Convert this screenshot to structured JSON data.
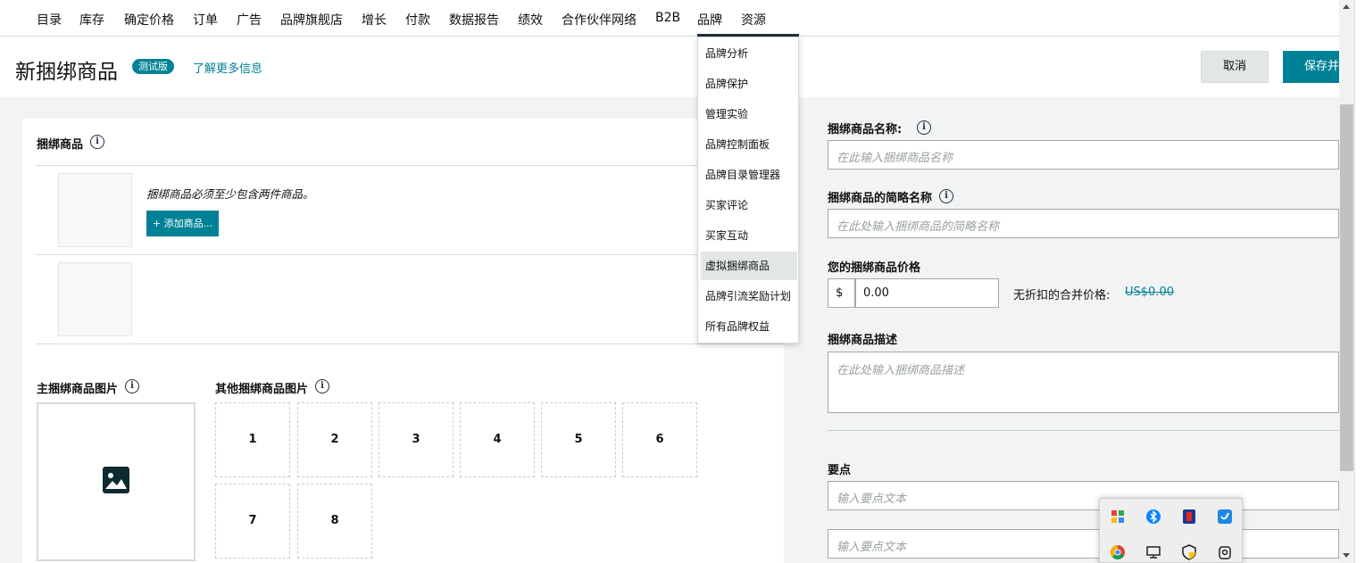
{
  "nav": {
    "items": [
      "目录",
      "库存",
      "确定价格",
      "订单",
      "广告",
      "品牌旗舰店",
      "增长",
      "付款",
      "数据报告",
      "绩效",
      "合作伙伴网络",
      "B2B",
      "品牌",
      "资源"
    ],
    "active": "品牌"
  },
  "header": {
    "title": "新捆绑商品",
    "badge": "测试版",
    "learn_more": "了解更多信息",
    "cancel": "取消",
    "save": "保存并"
  },
  "bundle": {
    "heading": "捆绑商品",
    "hint": "捆绑商品必须至少包含两件商品。",
    "add_button": "+ 添加商品..."
  },
  "images": {
    "main_heading": "主捆绑商品图片",
    "other_heading": "其他捆绑商品图片",
    "slots": [
      "1",
      "2",
      "3",
      "4",
      "5",
      "6",
      "7",
      "8"
    ]
  },
  "form": {
    "name_label": "捆绑商品名称:",
    "name_placeholder": "在此输入捆绑商品名称",
    "short_label": "捆绑商品的简略名称",
    "short_placeholder": "在此处输入捆绑商品的简略名称",
    "price_label": "您的捆绑商品价格",
    "currency": "$",
    "price_value": "0.00",
    "list_label": "无折扣的合并价格:",
    "list_value": "US$0.00",
    "desc_label": "捆绑商品描述",
    "desc_placeholder": "在此处输入捆绑商品描述",
    "points_label": "要点",
    "point_placeholder": "输入要点文本"
  },
  "dropdown": {
    "items": [
      "品牌分析",
      "品牌保护",
      "管理实验",
      "品牌控制面板",
      "品牌目录管理器",
      "买家评论",
      "买家互动",
      "虚拟捆绑商品",
      "品牌引流奖励计划",
      "所有品牌权益"
    ],
    "highlighted": "虚拟捆绑商品"
  },
  "tray": {
    "icons": [
      "color-app-icon",
      "bluetooth-icon",
      "red-app-icon",
      "blue-app-icon",
      "chrome-icon",
      "network-icon",
      "security-shield-icon",
      "camera-icon"
    ]
  },
  "colors": {
    "accent": "#008296",
    "nav_dark": "#232f3e",
    "bg": "#f2f4f4"
  }
}
